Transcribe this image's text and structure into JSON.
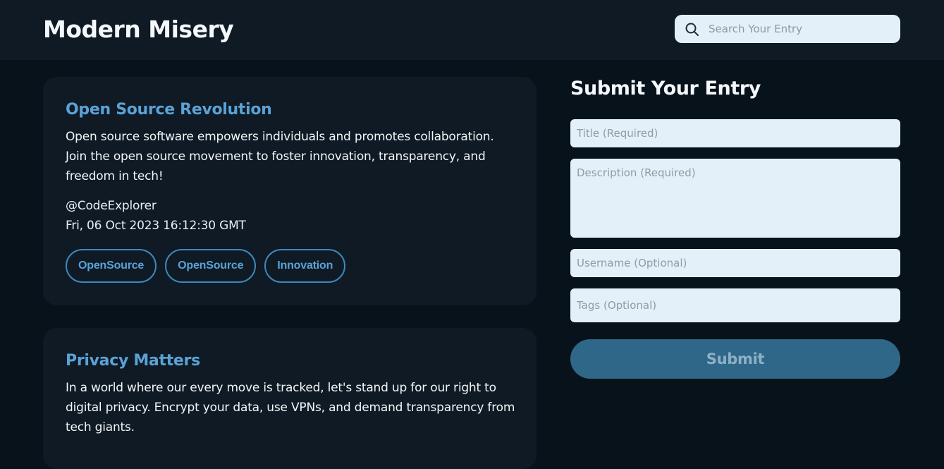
{
  "header": {
    "brand": "Modern Misery",
    "search_placeholder": "Search Your Entry"
  },
  "entries": [
    {
      "title": "Open Source Revolution",
      "description": "Open source software empowers individuals and promotes collaboration. Join the open source movement to foster innovation, transparency, and freedom in tech!",
      "username": "@CodeExplorer",
      "date": "Fri, 06 Oct 2023 16:12:30 GMT",
      "tags": [
        "OpenSource",
        "OpenSource",
        "Innovation"
      ]
    },
    {
      "title": "Privacy Matters",
      "description": "In a world where our every move is tracked, let's stand up for our right to digital privacy. Encrypt your data, use VPNs, and demand transparency from tech giants."
    }
  ],
  "form": {
    "heading": "Submit Your Entry",
    "title_placeholder": "Title (Required)",
    "description_placeholder": "Description (Required)",
    "username_placeholder": "Username (Optional)",
    "tags_placeholder": "Tags (Optional)",
    "submit_label": "Submit"
  },
  "icons": {
    "search": "search-icon"
  },
  "colors": {
    "background": "#08121b",
    "surface": "#0f1a24",
    "accent": "#5aa2d6",
    "input_bg": "#e3f0fa",
    "submit_bg": "#2f6788"
  }
}
